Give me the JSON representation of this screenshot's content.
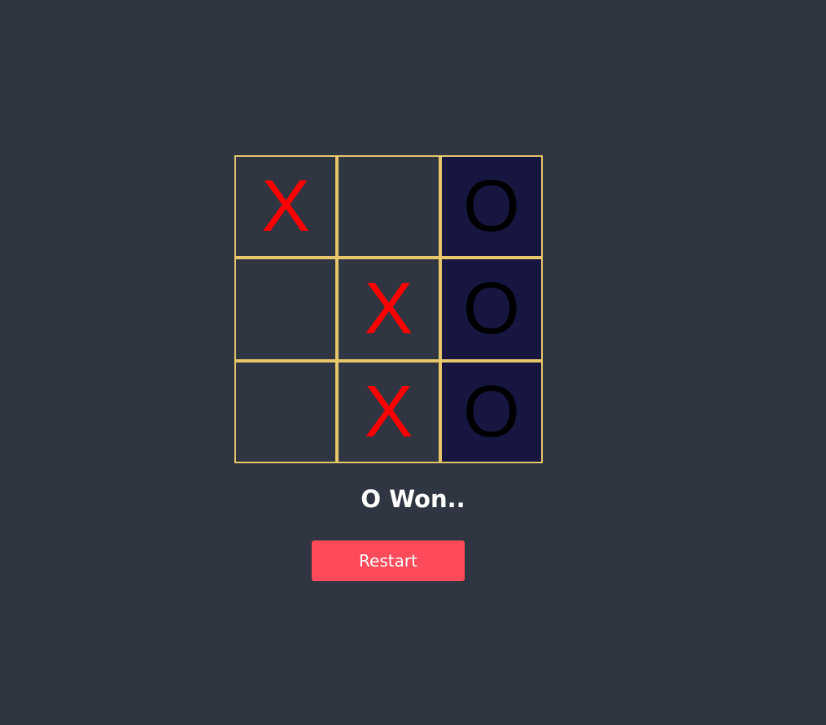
{
  "board": {
    "cells": [
      {
        "mark": "X",
        "player": "x",
        "winning": false
      },
      {
        "mark": "",
        "player": "",
        "winning": false
      },
      {
        "mark": "O",
        "player": "o",
        "winning": true
      },
      {
        "mark": "",
        "player": "",
        "winning": false
      },
      {
        "mark": "X",
        "player": "x",
        "winning": false
      },
      {
        "mark": "O",
        "player": "o",
        "winning": true
      },
      {
        "mark": "",
        "player": "",
        "winning": false
      },
      {
        "mark": "X",
        "player": "x",
        "winning": false
      },
      {
        "mark": "O",
        "player": "o",
        "winning": true
      }
    ],
    "colors": {
      "grid_line": "#e7c76a",
      "x_mark": "#ff0000",
      "o_mark": "#000000",
      "winning_cell": "#161640",
      "background": "#303542"
    }
  },
  "status": {
    "text": "O Won.."
  },
  "controls": {
    "restart_label": "Restart",
    "restart_color": "#ff4a5a"
  }
}
